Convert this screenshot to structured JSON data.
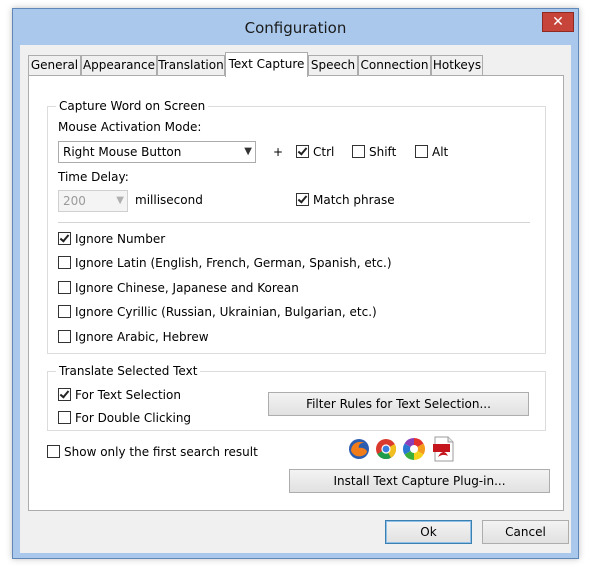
{
  "window": {
    "title": "Configuration",
    "close_glyph": "✕"
  },
  "tabs": [
    {
      "label": "General"
    },
    {
      "label": "Appearance"
    },
    {
      "label": "Translation"
    },
    {
      "label": "Text Capture"
    },
    {
      "label": "Speech"
    },
    {
      "label": "Connection"
    },
    {
      "label": "Hotkeys"
    }
  ],
  "capture": {
    "group_title": "Capture Word on Screen",
    "activation_label": "Mouse Activation Mode:",
    "activation_value": "Right Mouse Button",
    "plus": "+",
    "ctrl": {
      "label": "Ctrl",
      "checked": true
    },
    "shift": {
      "label": "Shift",
      "checked": false
    },
    "alt": {
      "label": "Alt",
      "checked": false
    },
    "delay_label": "Time Delay:",
    "delay_value": "200",
    "delay_unit": "millisecond",
    "match_phrase": {
      "label": "Match phrase",
      "checked": true
    },
    "ignore": [
      {
        "label": "Ignore Number",
        "checked": true
      },
      {
        "label": "Ignore Latin (English, French, German, Spanish, etc.)",
        "checked": false
      },
      {
        "label": "Ignore Chinese, Japanese and Korean",
        "checked": false
      },
      {
        "label": "Ignore Cyrillic (Russian, Ukrainian, Bulgarian, etc.)",
        "checked": false
      },
      {
        "label": "Ignore Arabic, Hebrew",
        "checked": false
      }
    ]
  },
  "translate": {
    "group_title": "Translate Selected Text",
    "for_selection": {
      "label": "For Text Selection",
      "checked": true
    },
    "for_double_click": {
      "label": "For Double Clicking",
      "checked": false
    },
    "filter_button": "Filter Rules for Text Selection..."
  },
  "first_result": {
    "label": "Show only the first search result",
    "checked": false
  },
  "plugin_icons": [
    "firefox-icon",
    "chrome-icon",
    "picasa-icon",
    "pdf-icon"
  ],
  "install_button": "Install Text Capture Plug-in...",
  "footer": {
    "ok": "Ok",
    "cancel": "Cancel"
  },
  "colors": {
    "title_bar": "#a9c8ec",
    "close": "#c7443a",
    "accent": "#3c7fb1"
  }
}
